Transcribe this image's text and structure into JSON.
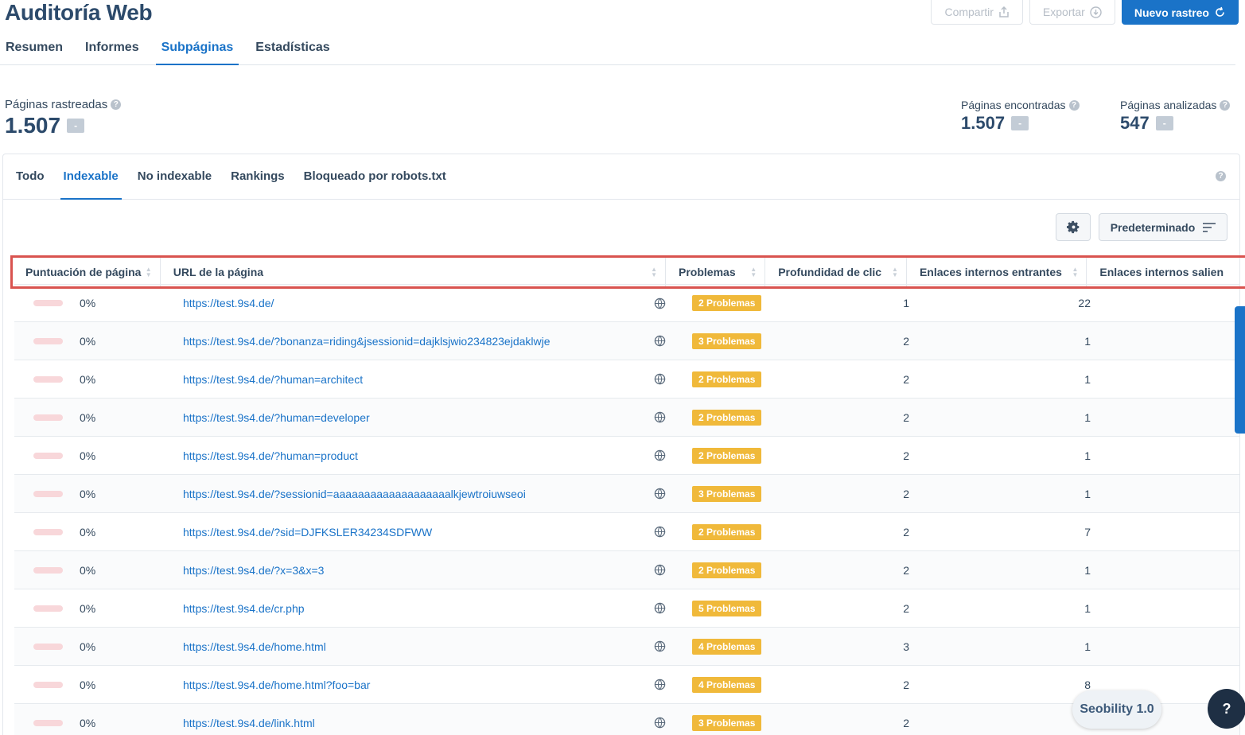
{
  "title": "Auditoría Web",
  "actions": {
    "share": "Compartir",
    "export": "Exportar",
    "new_crawl": "Nuevo rastreo"
  },
  "main_tabs": [
    "Resumen",
    "Informes",
    "Subpáginas",
    "Estadísticas"
  ],
  "active_main_tab": "Subpáginas",
  "stats": {
    "crawled": {
      "label": "Páginas rastreadas",
      "value": "1.507",
      "badge": "-"
    },
    "found": {
      "label": "Páginas encontradas",
      "value": "1.507",
      "badge": "-"
    },
    "analyzed": {
      "label": "Páginas analizadas",
      "value": "547",
      "badge": "-"
    }
  },
  "sub_tabs": [
    "Todo",
    "Indexable",
    "No indexable",
    "Rankings",
    "Bloqueado por robots.txt"
  ],
  "active_sub_tab": "Indexable",
  "default_button": "Predeterminado",
  "columns": [
    "Puntuación de página",
    "URL de la página",
    "Problemas",
    "Profundidad de clic",
    "Enlaces internos entrantes",
    "Enlaces internos salien"
  ],
  "rows": [
    {
      "score": "0%",
      "url": "https://test.9s4.de/",
      "problems": "2 Problemas",
      "depth": "1",
      "links": "22"
    },
    {
      "score": "0%",
      "url": "https://test.9s4.de/?bonanza=riding&jsessionid=dajklsjwio234823ejdaklwje",
      "problems": "3 Problemas",
      "depth": "2",
      "links": "1"
    },
    {
      "score": "0%",
      "url": "https://test.9s4.de/?human=architect",
      "problems": "2 Problemas",
      "depth": "2",
      "links": "1"
    },
    {
      "score": "0%",
      "url": "https://test.9s4.de/?human=developer",
      "problems": "2 Problemas",
      "depth": "2",
      "links": "1"
    },
    {
      "score": "0%",
      "url": "https://test.9s4.de/?human=product",
      "problems": "2 Problemas",
      "depth": "2",
      "links": "1"
    },
    {
      "score": "0%",
      "url": "https://test.9s4.de/?sessionid=aaaaaaaaaaaaaaaaaaalkjewtroiuwseoi",
      "problems": "3 Problemas",
      "depth": "2",
      "links": "1"
    },
    {
      "score": "0%",
      "url": "https://test.9s4.de/?sid=DJFKSLER34234SDFWW",
      "problems": "2 Problemas",
      "depth": "2",
      "links": "7"
    },
    {
      "score": "0%",
      "url": "https://test.9s4.de/?x=3&x=3",
      "problems": "2 Problemas",
      "depth": "2",
      "links": "1"
    },
    {
      "score": "0%",
      "url": "https://test.9s4.de/cr.php",
      "problems": "5 Problemas",
      "depth": "2",
      "links": "1"
    },
    {
      "score": "0%",
      "url": "https://test.9s4.de/home.html",
      "problems": "4 Problemas",
      "depth": "3",
      "links": "1"
    },
    {
      "score": "0%",
      "url": "https://test.9s4.de/home.html?foo=bar",
      "problems": "4 Problemas",
      "depth": "2",
      "links": "8"
    },
    {
      "score": "0%",
      "url": "https://test.9s4.de/link.html",
      "problems": "3 Problemas",
      "depth": "2",
      "links": ""
    }
  ],
  "seobility_label": "Seobility 1.0",
  "help_label": "?",
  "colors": {
    "accent": "#1a73c8",
    "badge": "#f0b93a",
    "highlight": "#d9534f"
  }
}
